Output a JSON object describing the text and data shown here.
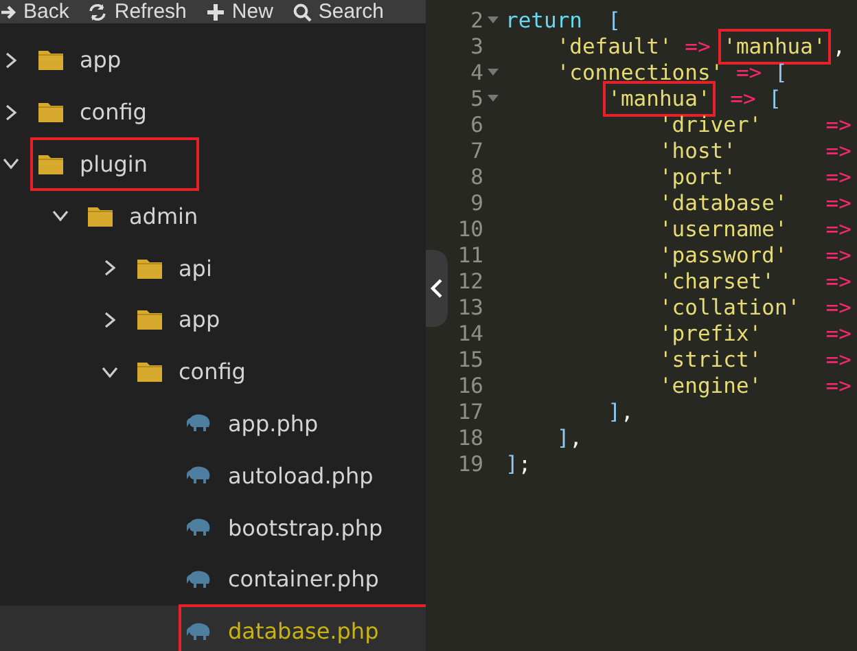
{
  "toolbar": {
    "buttons": [
      {
        "kind": "back",
        "label": "Back"
      },
      {
        "kind": "refresh",
        "label": "Refresh"
      },
      {
        "kind": "new",
        "label": "New"
      },
      {
        "kind": "search",
        "label": "Search"
      }
    ]
  },
  "file_tree": [
    {
      "name": "app",
      "kind": "folder",
      "expanded": false,
      "selected": false,
      "highlighted": false
    },
    {
      "name": "config",
      "kind": "folder",
      "expanded": false,
      "selected": false,
      "highlighted": false
    },
    {
      "name": "plugin",
      "kind": "folder",
      "expanded": true,
      "selected": false,
      "highlighted": true,
      "children": [
        {
          "name": "admin",
          "kind": "folder",
          "expanded": true,
          "selected": false,
          "highlighted": false,
          "children": [
            {
              "name": "api",
              "kind": "folder",
              "expanded": false,
              "selected": false,
              "highlighted": false
            },
            {
              "name": "app",
              "kind": "folder",
              "expanded": false,
              "selected": false,
              "highlighted": false
            },
            {
              "name": "config",
              "kind": "folder",
              "expanded": true,
              "selected": false,
              "highlighted": false,
              "children": [
                {
                  "name": "app.php",
                  "kind": "file",
                  "selected": false,
                  "highlighted": false
                },
                {
                  "name": "autoload.php",
                  "kind": "file",
                  "selected": false,
                  "highlighted": false
                },
                {
                  "name": "bootstrap.php",
                  "kind": "file",
                  "selected": false,
                  "highlighted": false
                },
                {
                  "name": "container.php",
                  "kind": "file",
                  "selected": false,
                  "highlighted": false
                },
                {
                  "name": "database.php",
                  "kind": "file",
                  "selected": true,
                  "highlighted": true
                }
              ]
            }
          ]
        }
      ]
    }
  ],
  "editor": {
    "lines": [
      {
        "number": "2",
        "tokens": [
          {
            "kind": "keyword",
            "text": "return"
          },
          {
            "kind": "bracket",
            "text": "["
          }
        ],
        "children": [
          {
            "number": "3",
            "tokens": [
              {
                "kind": "string",
                "text": "'default'"
              },
              {
                "kind": "operator",
                "text": "=>"
              },
              {
                "kind": "string",
                "text": "'manhua'",
                "highlighted": true
              },
              {
                "kind": "punct",
                "text": ","
              }
            ]
          },
          {
            "number": "4",
            "tokens": [
              {
                "kind": "string",
                "text": "'connections'"
              },
              {
                "kind": "operator",
                "text": "=>"
              },
              {
                "kind": "bracket",
                "text": "["
              }
            ],
            "children": [
              {
                "number": "5",
                "tokens": [
                  {
                    "kind": "string",
                    "text": "'manhua'",
                    "highlighted": true
                  },
                  {
                    "kind": "operator",
                    "text": "=>"
                  },
                  {
                    "kind": "bracket",
                    "text": "["
                  }
                ],
                "children": [
                  {
                    "number": "6",
                    "tokens": [
                      {
                        "kind": "key",
                        "text": "'driver'"
                      },
                      {
                        "kind": "operator",
                        "text": "=>"
                      }
                    ]
                  },
                  {
                    "number": "7",
                    "tokens": [
                      {
                        "kind": "key",
                        "text": "'host'"
                      },
                      {
                        "kind": "operator",
                        "text": "=>"
                      }
                    ]
                  },
                  {
                    "number": "8",
                    "tokens": [
                      {
                        "kind": "key",
                        "text": "'port'"
                      },
                      {
                        "kind": "operator",
                        "text": "=>"
                      }
                    ]
                  },
                  {
                    "number": "9",
                    "tokens": [
                      {
                        "kind": "key",
                        "text": "'database'"
                      },
                      {
                        "kind": "operator",
                        "text": "=>"
                      }
                    ]
                  },
                  {
                    "number": "10",
                    "tokens": [
                      {
                        "kind": "key",
                        "text": "'username'"
                      },
                      {
                        "kind": "operator",
                        "text": "=>"
                      }
                    ]
                  },
                  {
                    "number": "11",
                    "tokens": [
                      {
                        "kind": "key",
                        "text": "'password'"
                      },
                      {
                        "kind": "operator",
                        "text": "=>"
                      }
                    ]
                  },
                  {
                    "number": "12",
                    "tokens": [
                      {
                        "kind": "key",
                        "text": "'charset'"
                      },
                      {
                        "kind": "operator",
                        "text": "=>"
                      }
                    ]
                  },
                  {
                    "number": "13",
                    "tokens": [
                      {
                        "kind": "key",
                        "text": "'collation'"
                      },
                      {
                        "kind": "operator",
                        "text": "=>"
                      }
                    ]
                  },
                  {
                    "number": "14",
                    "tokens": [
                      {
                        "kind": "key",
                        "text": "'prefix'"
                      },
                      {
                        "kind": "operator",
                        "text": "=>"
                      }
                    ]
                  },
                  {
                    "number": "15",
                    "tokens": [
                      {
                        "kind": "key",
                        "text": "'strict'"
                      },
                      {
                        "kind": "operator",
                        "text": "=>"
                      }
                    ]
                  },
                  {
                    "number": "16",
                    "tokens": [
                      {
                        "kind": "key",
                        "text": "'engine'"
                      },
                      {
                        "kind": "operator",
                        "text": "=>"
                      }
                    ]
                  }
                ]
              },
              {
                "number": "17",
                "tokens": [
                  {
                    "kind": "bracket",
                    "text": "]"
                  },
                  {
                    "kind": "punct",
                    "text": ","
                  }
                ]
              }
            ]
          },
          {
            "number": "18",
            "tokens": [
              {
                "kind": "bracket",
                "text": "]"
              },
              {
                "kind": "punct",
                "text": ","
              }
            ]
          }
        ]
      },
      {
        "number": "19",
        "tokens": [
          {
            "kind": "bracket",
            "text": "]"
          },
          {
            "kind": "punct",
            "text": ";"
          }
        ]
      }
    ]
  }
}
